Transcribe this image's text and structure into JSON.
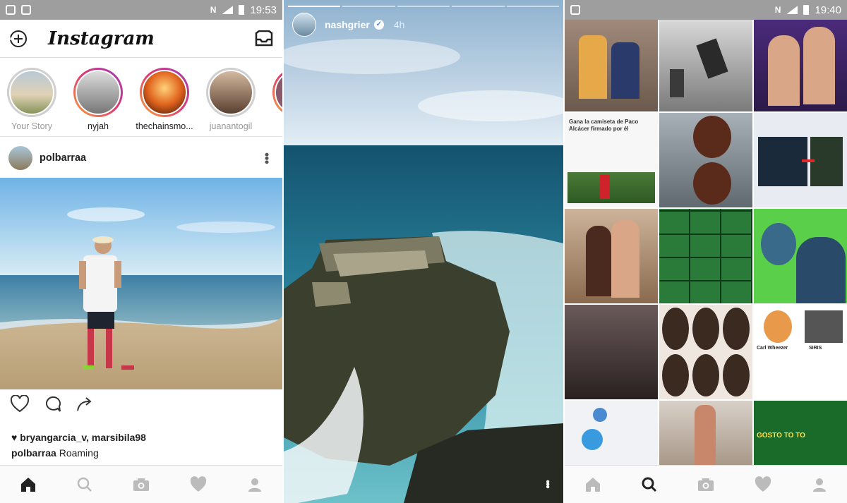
{
  "feed": {
    "status_time": "19:53",
    "title": "Instagram",
    "stories": [
      {
        "name": "Your Story",
        "ring": "none"
      },
      {
        "name": "nyjah",
        "ring": "unseen"
      },
      {
        "name": "thechainsmo...",
        "ring": "unseen"
      },
      {
        "name": "juanantogil",
        "ring": "seen"
      }
    ],
    "post": {
      "username": "polbarraa",
      "likes": "bryangarcia_v, marsibila98",
      "caption_user": "polbarraa",
      "caption_text": "Roaming"
    },
    "nav": [
      "home-icon",
      "search-icon",
      "camera-icon",
      "heart-icon",
      "profile-icon"
    ],
    "active_nav": "home"
  },
  "story": {
    "username": "nashgrier",
    "time": "4h",
    "verified": true,
    "progress_segments": 5,
    "progress_done": 1
  },
  "explore": {
    "status_time": "19:40",
    "active_nav": "search",
    "tiles": [
      {
        "text": "Gana la camiseta de Paco Alcácer firmado por él"
      },
      {
        "text": "Carl Wheezer"
      },
      {
        "text": "SIRIS"
      },
      {
        "text": "GOSTO TO TO"
      }
    ]
  },
  "colors": {
    "status_bar": "#9e9e9e",
    "story_gradient_start": "#f9a53b",
    "story_gradient_end": "#9b3ab8",
    "text_primary": "#222222"
  }
}
